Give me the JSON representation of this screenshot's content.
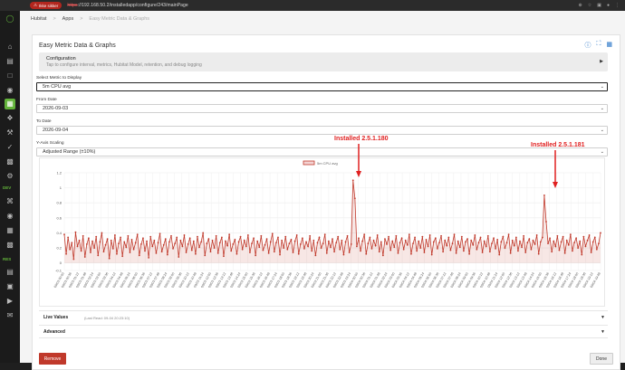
{
  "browser": {
    "unsafe_label": "Ikke sikker",
    "url_scheme": "https",
    "url_rest": "://192.168.50.2/installedapp/configure/243/mainPage"
  },
  "sidebar": {
    "sections": [
      "DEV",
      "RES"
    ]
  },
  "breadcrumb": [
    "Hubitat",
    "Apps",
    "Easy Metric Data & Graphs"
  ],
  "app": {
    "title": "Easy Metric Data & Graphs",
    "config_header": "Configuration",
    "config_sub": "Tap to configure interval, metrics, Hubitat Model, retention, and debug logging",
    "metric_label": "Select Metric to Display",
    "metric_value": "5m CPU avg",
    "from_label": "From Date",
    "from_value": "2026-09-03",
    "to_label": "To Date",
    "to_value": "2026-09-04",
    "scaling_label": "Y-Axis Scaling",
    "scaling_value": "Adjusted Range (±10%)",
    "live_values_label": "Live Values",
    "live_values_sub": "(Last Read: 09-04 20:23:10)",
    "advanced_label": "Advanced",
    "remove_label": "Remove",
    "done_label": "Done"
  },
  "annotations": {
    "a1": "Installed 2.5.1.180",
    "a2": "Installed 2.5.1.181"
  },
  "chart_data": {
    "type": "line",
    "legend": "5m CPU avg",
    "legend_position": "top-center",
    "ylim": [
      -0.1,
      1.2
    ],
    "yticks": [
      1.2,
      1.0,
      0.8,
      0.6,
      0.4,
      0.2,
      0,
      -0.1
    ],
    "grid": true,
    "color": "#c0392b",
    "x_tick_labels": [
      "09/03 00:00",
      "09/03 00:36",
      "09/03 01:12",
      "09/03 01:48",
      "09/03 02:24",
      "09/03 03:00",
      "09/03 03:36",
      "09/03 04:12",
      "09/03 04:48",
      "09/03 05:24",
      "09/03 06:00",
      "09/03 06:36",
      "09/03 07:12",
      "09/03 07:48",
      "09/03 08:24",
      "09/03 09:00",
      "09/03 09:36",
      "09/03 10:12",
      "09/03 10:48",
      "09/03 11:24",
      "09/03 12:00",
      "09/03 12:36",
      "09/03 13:12",
      "09/03 13:48",
      "09/03 14:24",
      "09/03 15:00",
      "09/03 15:36",
      "09/03 16:12",
      "09/03 16:48",
      "09/03 17:24",
      "09/03 18:00",
      "09/03 18:36",
      "09/03 19:12",
      "09/03 19:48",
      "09/03 20:24",
      "09/03 21:00",
      "09/03 21:36",
      "09/03 22:12",
      "09/03 22:48",
      "09/03 23:24",
      "09/04 00:00",
      "09/04 00:36",
      "09/04 01:12",
      "09/04 01:48",
      "09/04 02:24",
      "09/04 03:00",
      "09/04 03:36",
      "09/04 04:12",
      "09/04 04:48",
      "09/04 05:24",
      "09/04 06:00",
      "09/04 06:36",
      "09/04 07:12",
      "09/04 07:48",
      "09/04 08:24",
      "09/04 09:00",
      "09/04 09:36",
      "09/04 10:12",
      "09/04 10:48",
      "09/04 11:24",
      "09/04 12:00",
      "09/04 12:36",
      "09/04 13:12",
      "09/04 13:48",
      "09/04 14:24",
      "09/04 15:00",
      "09/04 15:36",
      "09/04 16:12",
      "09/04 16:48",
      "09/04 17:24",
      "09/04 18:00",
      "09/04 18:36",
      "09/04 19:12",
      "09/04 19:48"
    ],
    "values": [
      0.38,
      0.12,
      0.34,
      0.18,
      0.27,
      0.05,
      0.41,
      0.22,
      0.3,
      0.16,
      0.36,
      0.08,
      0.25,
      0.33,
      0.14,
      0.29,
      0.2,
      0.35,
      0.1,
      0.28,
      0.4,
      0.15,
      0.24,
      0.32,
      0.06,
      0.3,
      0.19,
      0.37,
      0.12,
      0.26,
      0.34,
      0.09,
      0.28,
      0.21,
      0.36,
      0.14,
      0.31,
      0.18,
      0.27,
      0.38,
      0.1,
      0.25,
      0.33,
      0.16,
      0.29,
      0.07,
      0.35,
      0.22,
      0.3,
      0.13,
      0.27,
      0.39,
      0.15,
      0.24,
      0.32,
      0.11,
      0.28,
      0.36,
      0.19,
      0.26,
      0.34,
      0.08,
      0.3,
      0.22,
      0.37,
      0.14,
      0.25,
      0.33,
      0.17,
      0.29,
      0.12,
      0.35,
      0.21,
      0.28,
      0.4,
      0.1,
      0.26,
      0.32,
      0.15,
      0.3,
      0.2,
      0.36,
      0.13,
      0.27,
      0.34,
      0.09,
      0.29,
      0.23,
      0.38,
      0.16,
      0.25,
      0.31,
      0.12,
      0.28,
      0.35,
      0.18,
      0.3,
      0.22,
      0.37,
      0.14,
      0.26,
      0.33,
      0.1,
      0.29,
      0.21,
      0.36,
      0.17,
      0.24,
      0.32,
      0.13,
      0.28,
      0.39,
      0.15,
      0.27,
      0.34,
      0.11,
      0.3,
      0.2,
      0.35,
      0.18,
      0.26,
      0.31,
      0.14,
      0.29,
      0.37,
      0.12,
      0.25,
      0.33,
      0.19,
      0.28,
      0.22,
      0.36,
      0.16,
      0.3,
      0.1,
      0.27,
      0.34,
      0.2,
      0.26,
      0.38,
      0.13,
      0.29,
      0.21,
      0.32,
      0.15,
      0.27,
      0.35,
      0.18,
      0.3,
      0.11,
      0.28,
      0.36,
      0.14,
      0.25,
      1.1,
      0.86,
      0.22,
      0.33,
      0.16,
      0.29,
      0.38,
      0.12,
      0.26,
      0.34,
      0.19,
      0.3,
      0.23,
      0.37,
      0.15,
      0.28,
      0.1,
      0.32,
      0.25,
      0.35,
      0.17,
      0.29,
      0.21,
      0.36,
      0.13,
      0.27,
      0.33,
      0.18,
      0.3,
      0.24,
      0.38,
      0.12,
      0.26,
      0.34,
      0.16,
      0.29,
      0.2,
      0.35,
      0.14,
      0.31,
      0.22,
      0.37,
      0.11,
      0.28,
      0.33,
      0.19,
      0.27,
      0.36,
      0.15,
      0.3,
      0.23,
      0.34,
      0.17,
      0.26,
      0.38,
      0.13,
      0.29,
      0.21,
      0.35,
      0.16,
      0.28,
      0.32,
      0.12,
      0.3,
      0.24,
      0.37,
      0.18,
      0.27,
      0.34,
      0.14,
      0.29,
      0.22,
      0.36,
      0.15,
      0.26,
      0.33,
      0.19,
      0.31,
      0.11,
      0.28,
      0.35,
      0.2,
      0.27,
      0.38,
      0.13,
      0.3,
      0.23,
      0.34,
      0.16,
      0.29,
      0.21,
      0.36,
      0.14,
      0.27,
      0.32,
      0.18,
      0.3,
      0.25,
      0.37,
      0.12,
      0.28,
      0.34,
      0.9,
      0.55,
      0.26,
      0.33,
      0.15,
      0.29,
      0.22,
      0.36,
      0.17,
      0.28,
      0.35,
      0.13,
      0.3,
      0.24,
      0.38,
      0.16,
      0.27,
      0.33,
      0.2,
      0.29,
      0.11,
      0.35,
      0.22,
      0.3,
      0.37,
      0.14,
      0.28,
      0.34,
      0.18,
      0.26,
      0.4
    ]
  }
}
